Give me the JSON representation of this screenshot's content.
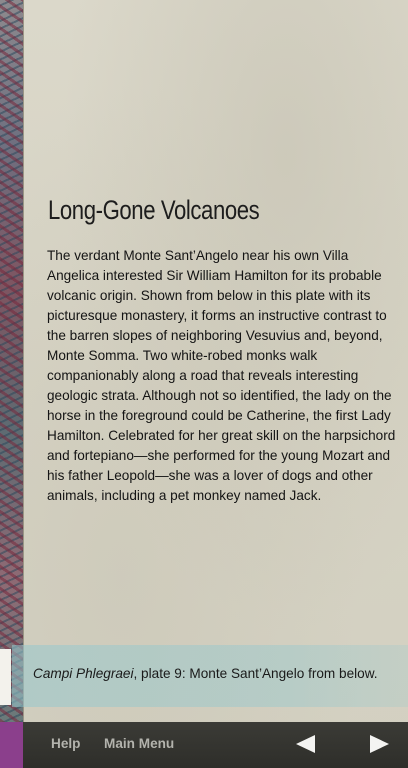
{
  "article": {
    "title": "Long-Gone Volcanoes",
    "body": "The verdant Monte Sant’Angelo near his own Villa Angelica interested Sir William Hamilton for its probable volcanic origin. Shown from below in this plate with its picturesque monastery, it forms an instructive contrast to the barren slopes of neighboring Vesuvius and, beyond, Monte Somma. Two white-robed monks walk companionably along a road that reveals interesting geologic strata. Although not so identified, the lady on the horse in the foreground could be Catherine, the first Lady Hamilton. Celebrated for her great skill on the harpsichord and fortepiano—she performed for the young Mozart and his father Leopold—she was a lover of dogs and other animals, including a pet monkey named Jack."
  },
  "caption": {
    "title_italic": "Campi Phlegraei",
    "text": ", plate 9: Monte Sant’Angelo from below."
  },
  "toolbar": {
    "help_label": "Help",
    "main_menu_label": "Main Menu",
    "prev_icon": "left-arrow-icon",
    "next_icon": "right-arrow-icon",
    "accent_color": "#8b3f8c"
  }
}
